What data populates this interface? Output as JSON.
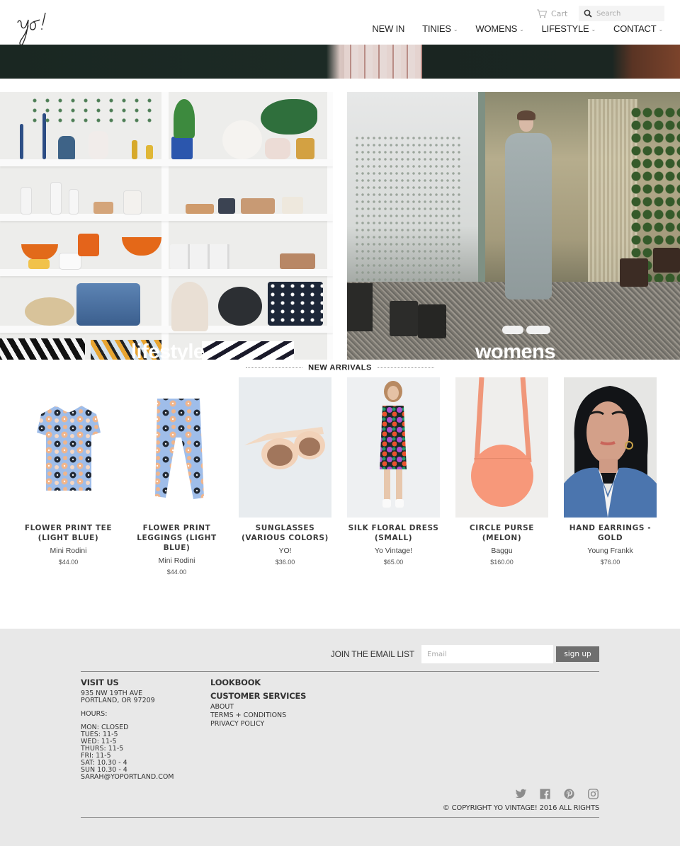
{
  "header": {
    "logo_text": "yo!",
    "cart_label": "Cart",
    "search_placeholder": "Search",
    "nav": [
      {
        "label": "NEW IN",
        "has_dropdown": false
      },
      {
        "label": "TINIES",
        "has_dropdown": true
      },
      {
        "label": "WOMENS",
        "has_dropdown": true
      },
      {
        "label": "LIFESTYLE",
        "has_dropdown": true
      },
      {
        "label": "CONTACT",
        "has_dropdown": true
      }
    ],
    "dropdown_glyph": "⌄"
  },
  "tiles": [
    {
      "label": "lifestyle"
    },
    {
      "label": "womens"
    }
  ],
  "new_arrivals": {
    "title": "NEW ARRIVALS",
    "products": [
      {
        "title": "FLOWER PRINT TEE (LIGHT BLUE)",
        "vendor": "Mini Rodini",
        "price": "$44.00"
      },
      {
        "title": "FLOWER PRINT LEGGINGS (LIGHT BLUE)",
        "vendor": "Mini Rodini",
        "price": "$44.00"
      },
      {
        "title": "SUNGLASSES (VARIOUS COLORS)",
        "vendor": "YO!",
        "price": "$36.00"
      },
      {
        "title": "SILK FLORAL DRESS (SMALL)",
        "vendor": "Yo Vintage!",
        "price": "$65.00"
      },
      {
        "title": "CIRCLE PURSE (MELON)",
        "vendor": "Baggu",
        "price": "$160.00"
      },
      {
        "title": "HAND EARRINGS - GOLD",
        "vendor": "Young Frankk",
        "price": "$76.00"
      }
    ]
  },
  "footer": {
    "signup_label": "JOIN THE EMAIL LIST",
    "email_placeholder": "Email",
    "signup_button": "sign up",
    "visit_us": {
      "heading": "VISIT US",
      "address_line1": "935 NW 19TH AVE",
      "address_line2": "PORTLAND, OR 97209",
      "hours_label": "HOURS:",
      "hours": [
        "MON: CLOSED",
        "TUES: 11-5",
        "WED: 11-5",
        "THURS: 11-5",
        "FRI: 11-5",
        "SAT: 10.30 - 4",
        "SUN 10.30 - 4"
      ],
      "email": "SARAH@YOPORTLAND.COM"
    },
    "lookbook": "LOOKBOOK",
    "customer_services": {
      "heading": "CUSTOMER SERVICES",
      "links": [
        "ABOUT",
        "TERMS + CONDITIONS",
        "PRIVACY POLICY"
      ]
    },
    "social": [
      "twitter",
      "facebook",
      "pinterest",
      "instagram"
    ],
    "copyright": "© COPYRIGHT YO VINTAGE! 2016 ALL RIGHTS"
  },
  "colors": {
    "footer_bg": "#e8e8e8",
    "signup_button_bg": "#6f6f6f",
    "text_dark": "#333333",
    "social_icon": "#8c8c8c"
  }
}
